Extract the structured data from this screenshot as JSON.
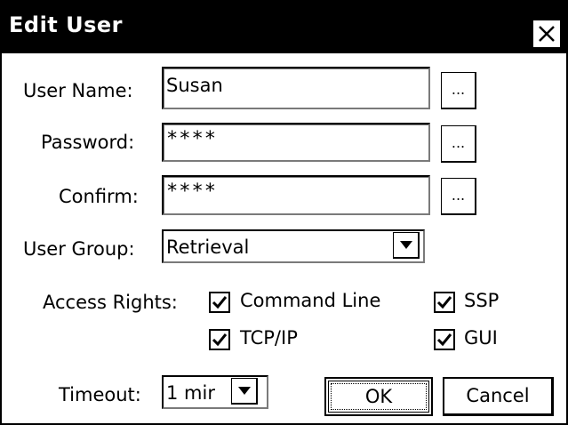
{
  "window": {
    "title": "Edit User",
    "close_icon": "close-icon"
  },
  "form": {
    "user_name": {
      "label": "User Name:",
      "value": "Susan",
      "browse_label": "..."
    },
    "password": {
      "label": "Password:",
      "value": "****",
      "browse_label": "..."
    },
    "confirm": {
      "label": "Confirm:",
      "value": "****",
      "browse_label": "..."
    },
    "user_group": {
      "label": "User Group:",
      "selected": "Retrieval"
    },
    "access_rights": {
      "label": "Access Rights:",
      "options": [
        {
          "label": "Command Line",
          "checked": true
        },
        {
          "label": "SSP",
          "checked": true
        },
        {
          "label": "TCP/IP",
          "checked": true
        },
        {
          "label": "GUI",
          "checked": true
        }
      ]
    },
    "timeout": {
      "label": "Timeout:",
      "selected": "1 mir"
    }
  },
  "buttons": {
    "ok_label": "OK",
    "cancel_label": "Cancel"
  },
  "colors": {
    "titlebar_bg": "#000000",
    "titlebar_text": "#ffffff",
    "window_bg": "#ffffff"
  }
}
